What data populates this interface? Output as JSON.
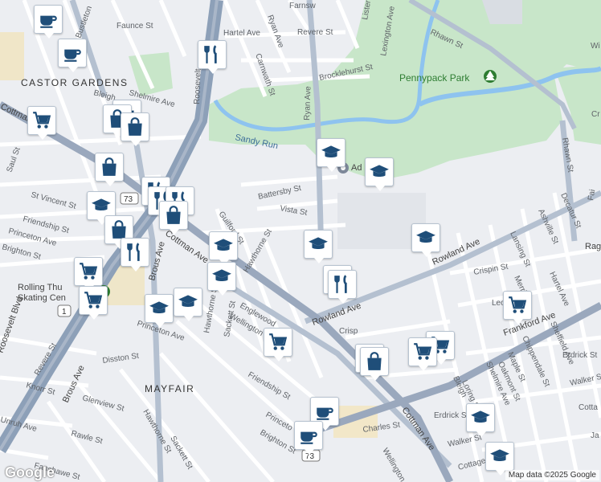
{
  "colors": {
    "park": "#c8e6c9",
    "water": "#8ec3ef",
    "highway": "#8da0b8",
    "arterial": "#a9b6c8",
    "street": "#ffffff",
    "pin_icon": "#1f4e79"
  },
  "neighborhoods": {
    "castor_gardens": "CASTOR GARDENS",
    "mayfair": "MAYFAIR"
  },
  "parks": {
    "pennypack": "Pennypack Park"
  },
  "water": {
    "sandy_run": "Sandy Run"
  },
  "places": {
    "school": "Ad     school",
    "rolling1": "Rolling Thu",
    "rolling2": "Skating Cen",
    "rag": "Rag"
  },
  "streets": {
    "bustleton": "Bustleton",
    "faunce": "Faunce St",
    "roosevelt_v": "Roosevelt",
    "shelmire": "Shelmire Ave",
    "bleigh": "Bleigh",
    "cottman_nw": "Cottman",
    "saul": "Saul St",
    "st_vincent": "St Vincent St",
    "friendship": "Friendship St",
    "princeton": "Princeton Ave",
    "brighton": "Brighton St",
    "hartel": "Hartel Ave",
    "revere": "Revere St",
    "farnsworth": "Farnsw",
    "lister": "Lister",
    "ryan_top": "Ryan Ave",
    "carnwath": "Carnwath St",
    "brocklehurst": "Brocklehurst St",
    "lexington": "Lexington Ave",
    "rhawn_top": "Rhawn St",
    "rhawn_right": "Rhawn St",
    "ryan_v": "Ryan Ave",
    "battersby": "Battersby St",
    "vista": "Vista St",
    "guilford": "Guilford St",
    "hawthorne_mid": "Hawthorne St",
    "rowland_mid": "Rowland Ave",
    "rowland_right": "Rowland Ave",
    "crispin": "Crispin St",
    "lansing": "Lansing St",
    "ashville": "Ashville St",
    "decatur": "Decatur St",
    "hartel_right": "Hartel Ave",
    "merriam": "Merriam",
    "leon": "Leon",
    "brous_mid": "Brous Ave",
    "cottman_mid": "Cottman Ave",
    "rooseveltblvd": "Roosevelt Blvd",
    "revere2": "Revere St",
    "knorr": "Knorr St",
    "disston": "Disston St",
    "glenview": "Glenview St",
    "hawthorne_low": "Hawthorne St",
    "sackett": "Sackett St",
    "unruh": "Unruh Ave",
    "rawle": "Rawle St",
    "fanshawe": "Fanshawe St",
    "brous_low": "Brous Ave",
    "englewood": "Englewood",
    "wellington": "Wellington",
    "sackett2": "Sackett St",
    "hawthorne2": "Hawthorne St",
    "princeton_ave2": "Princeton Ave",
    "friendship2": "Friendship St",
    "princeto": "Princeto",
    "brighton2": "Brighton St",
    "charles": "Charles St",
    "wellington2": "Wellington St",
    "cottman_low": "Cottman Ave",
    "frankford": "Frankford Ave",
    "erdrick": "Erdrick St",
    "erdrick2": "Erdrick St",
    "sheffield": "Sheffield Ave",
    "chippendale": "Chippendale St",
    "maple": "Maple St",
    "oakmont": "Oakmont St",
    "shelmire2": "Shelmire Ave",
    "loring": "Loring St",
    "bleigh2": "Bleigh",
    "walker": "Walker St",
    "walker2": "Walker S",
    "cottage": "Cottage",
    "crisp": "Crisp",
    "cotta": "Cotta",
    "ja": "Ja",
    "fair": "Fai",
    "cr": "Cr",
    "wi": "Wi"
  },
  "route_shields": {
    "r73a": "73",
    "r73b": "73",
    "r1": "1"
  },
  "icons": {
    "coffee": "coffee-cup",
    "food": "fork-knife",
    "shop": "shopping-bag",
    "grocery": "shopping-cart",
    "school": "graduation-cap",
    "park": "tree"
  },
  "attribution": "Map data ©2025 Google",
  "logo": "Google"
}
